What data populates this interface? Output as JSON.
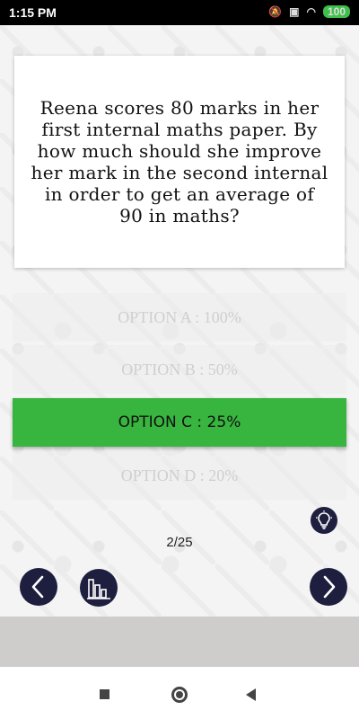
{
  "status_bar": {
    "time": "1:15 PM",
    "battery": "100"
  },
  "question": {
    "text": "Reena scores 80 marks in her first internal maths paper. By how much should she improve her mark in the second internal in order to get an average of 90 in maths?"
  },
  "options": [
    {
      "label": "OPTION A : 100%",
      "selected": false
    },
    {
      "label": "OPTION B : 50%",
      "selected": false
    },
    {
      "label": "OPTION C : 25%",
      "selected": true
    },
    {
      "label": "OPTION D : 20%",
      "selected": false
    }
  ],
  "progress": {
    "text": "2/25",
    "current": 2,
    "total": 25
  },
  "icons": {
    "hint": "lightbulb-icon",
    "prev": "chevron-left-icon",
    "next": "chevron-right-icon",
    "stats": "bar-chart-icon"
  },
  "colors": {
    "selected_option": "#38b53f",
    "nav_button": "#1e1e3e"
  }
}
